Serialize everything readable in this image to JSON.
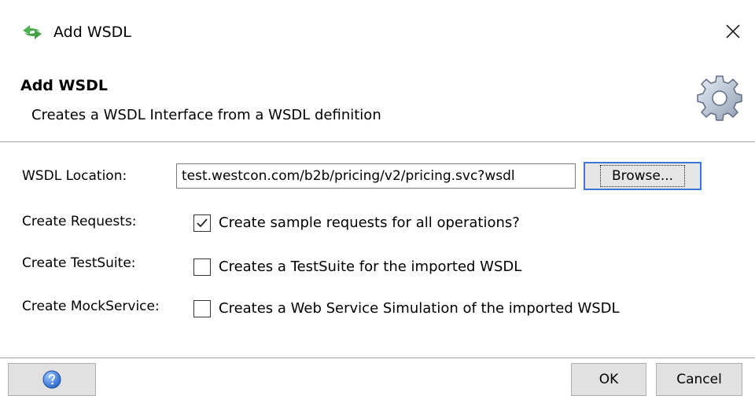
{
  "window": {
    "title": "Add WSDL",
    "icon": "soapui-logo-icon",
    "close_icon": "close-icon"
  },
  "banner": {
    "title": "Add WSDL",
    "description": "Creates a WSDL Interface from a WSDL definition",
    "icon": "gear-icon"
  },
  "form": {
    "wsdl_location": {
      "label": "WSDL Location:",
      "value": "test.westcon.com/b2b/pricing/v2/pricing.svc?wsdl",
      "browse_label": "Browse..."
    },
    "create_requests": {
      "label": "Create Requests:",
      "option": "Create sample requests for all operations?",
      "checked": true
    },
    "create_testsuite": {
      "label": "Create TestSuite:",
      "option": "Creates a TestSuite for the imported WSDL",
      "checked": false
    },
    "create_mockservice": {
      "label": "Create MockService:",
      "option": "Creates a Web Service Simulation of the imported WSDL",
      "checked": false
    }
  },
  "footer": {
    "help_icon": "help-icon",
    "ok_label": "OK",
    "cancel_label": "Cancel"
  },
  "colors": {
    "focus_border": "#3a78d6",
    "button_face": "#e1e1e1",
    "divider": "#a0a0a0",
    "help_blue": "#2b6fd1"
  }
}
